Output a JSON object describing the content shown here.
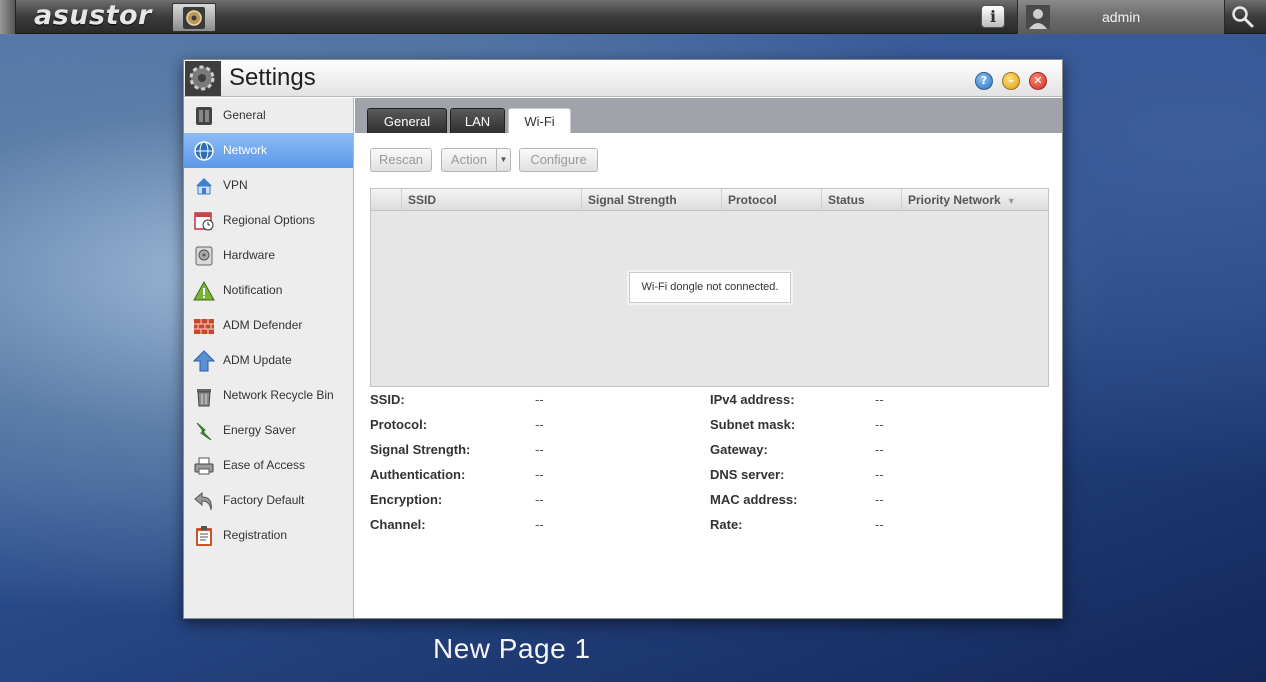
{
  "topbar": {
    "logo": "asustor",
    "username": "admin",
    "info_label": "i"
  },
  "window": {
    "title": "Settings",
    "help_label": "?",
    "min_label": "–",
    "close_label": "✕"
  },
  "sidebar": {
    "items": [
      {
        "label": "General",
        "icon": "server-icon"
      },
      {
        "label": "Network",
        "icon": "globe-network-icon"
      },
      {
        "label": "VPN",
        "icon": "vpn-house-icon"
      },
      {
        "label": "Regional Options",
        "icon": "calendar-clock-icon"
      },
      {
        "label": "Hardware",
        "icon": "hard-drive-icon"
      },
      {
        "label": "Notification",
        "icon": "warning-triangle-icon"
      },
      {
        "label": "ADM Defender",
        "icon": "firewall-brick-icon"
      },
      {
        "label": "ADM Update",
        "icon": "up-arrow-icon"
      },
      {
        "label": "Network Recycle Bin",
        "icon": "trash-bin-icon"
      },
      {
        "label": "Energy Saver",
        "icon": "lightning-icon"
      },
      {
        "label": "Ease of Access",
        "icon": "printer-icon"
      },
      {
        "label": "Factory Default",
        "icon": "undo-arrow-icon"
      },
      {
        "label": "Registration",
        "icon": "clipboard-icon"
      }
    ],
    "active_index": 1
  },
  "tabs": {
    "general": "General",
    "lan": "LAN",
    "wifi": "Wi-Fi",
    "selected": "Wi-Fi"
  },
  "toolbar": {
    "rescan": "Rescan",
    "action": "Action",
    "configure": "Configure"
  },
  "grid": {
    "columns": [
      "SSID",
      "Signal Strength",
      "Protocol",
      "Status",
      "Priority Network"
    ],
    "empty_message": "Wi-Fi dongle not connected."
  },
  "details": {
    "left": [
      {
        "label": "SSID:",
        "value": "--"
      },
      {
        "label": "Protocol:",
        "value": "--"
      },
      {
        "label": "Signal Strength:",
        "value": "--"
      },
      {
        "label": "Authentication:",
        "value": "--"
      },
      {
        "label": "Encryption:",
        "value": "--"
      },
      {
        "label": "Channel:",
        "value": "--"
      }
    ],
    "right": [
      {
        "label": "IPv4 address:",
        "value": "--"
      },
      {
        "label": "Subnet mask:",
        "value": "--"
      },
      {
        "label": "Gateway:",
        "value": "--"
      },
      {
        "label": "DNS server:",
        "value": "--"
      },
      {
        "label": "MAC address:",
        "value": "--"
      },
      {
        "label": "Rate:",
        "value": "--"
      }
    ]
  },
  "caption": "New Page 1",
  "colors": {
    "active_nav": "#5b97e8",
    "tab_dark": "#303030",
    "tabstrip_bg": "#a0a4aa"
  }
}
